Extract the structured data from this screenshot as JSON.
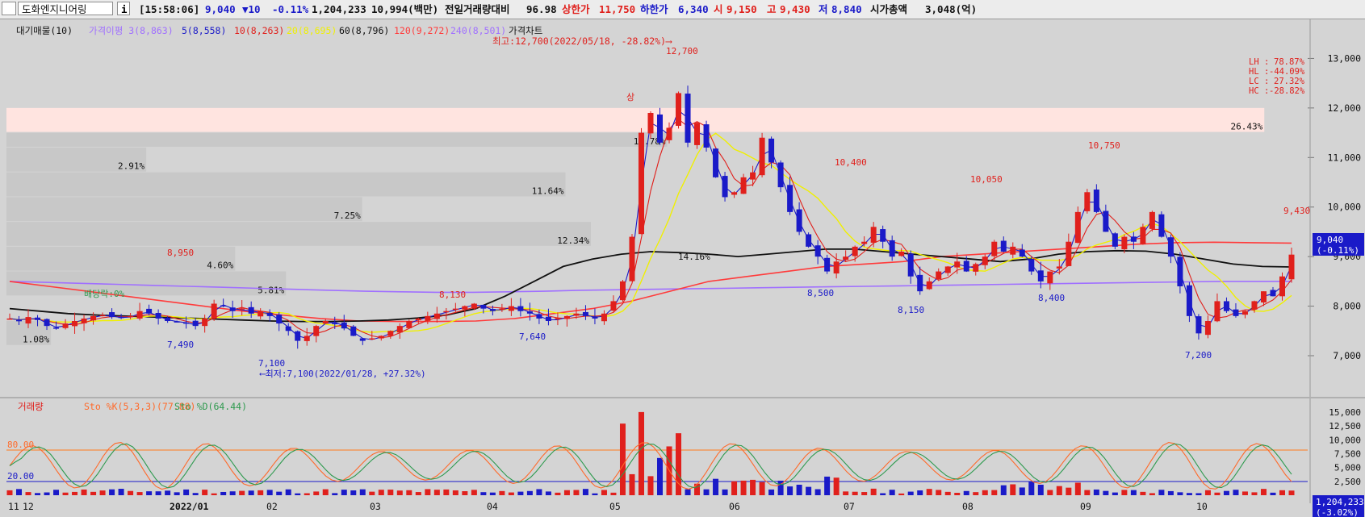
{
  "header": {
    "market_badge": "신",
    "stock_name": "도화엔지니어링",
    "info_button": "i",
    "time": "[15:58:06]",
    "price": "9,040",
    "change": "▼10",
    "change_pct": "-0.11%",
    "volume": "1,204,233",
    "amount": "10,994(백만)",
    "prev_vol_ratio_label": "전일거래량대비",
    "prev_vol_ratio": "96.98",
    "upper_limit_label": "상한가",
    "upper_limit": "11,750",
    "lower_limit_label": "하한가",
    "lower_limit": "6,340",
    "open_label": "시",
    "open": "9,150",
    "high_label": "고",
    "high": "9,430",
    "low_label": "저",
    "low": "8,840",
    "market_cap_label": "시가총액",
    "market_cap": "3,048(억)"
  },
  "colors": {
    "up": "#e0201c",
    "down": "#1a1ac8",
    "ma3": "#8a2be2",
    "ma5": "#1a1ac8",
    "ma10": "#e0201c",
    "ma20": "#f0f000",
    "ma60": "#111111",
    "ma120": "#ff3b3b",
    "ma240": "#a070ff",
    "stoK": "#ff6a2a",
    "stoD": "#2e9a4e",
    "bg": "#d4d4d4"
  },
  "chart_data": [
    {
      "type": "candlestick",
      "legend": [
        "대기매물(10)",
        "가격이평 3(8,863)",
        "5(8,558)",
        "10(8,263)",
        "20(8,695)",
        "60(8,796)",
        "120(9,272)",
        "240(8,501)",
        "가격차트"
      ],
      "yticks": [
        7000,
        8000,
        9000,
        10000,
        11000,
        12000,
        13000
      ],
      "ytick_labels": [
        "7,000",
        "8,000",
        "9,000",
        "10,000",
        "11,000",
        "12,000",
        "13,000"
      ],
      "ylim": [
        6300,
        13300
      ],
      "x_labels": [
        "11",
        "12",
        "2022/01",
        "02",
        "03",
        "04",
        "05",
        "06",
        "07",
        "08",
        "09",
        "10"
      ],
      "volume_profile": [
        {
          "low": 7200,
          "high": 7700,
          "pct": "1.08%",
          "fraction": 0.035
        },
        {
          "low": 7700,
          "high": 8200,
          "pct": "",
          "fraction": 0.0
        },
        {
          "low": 8200,
          "high": 8700,
          "pct": "5.81%",
          "fraction": 0.22
        },
        {
          "low": 8700,
          "high": 9200,
          "pct": "4.60%",
          "fraction": 0.18
        },
        {
          "low": 9200,
          "high": 9700,
          "pct": "12.34%",
          "fraction": 0.46
        },
        {
          "low": 9700,
          "high": 10200,
          "pct": "7.25%",
          "fraction": 0.28
        },
        {
          "low": 10200,
          "high": 10700,
          "pct": "11.64%",
          "fraction": 0.44
        },
        {
          "low": 10700,
          "high": 11200,
          "pct": "2.91%",
          "fraction": 0.11
        },
        {
          "low": 11500,
          "high": 12000,
          "pct": "26.43%",
          "fraction": 0.99
        },
        {
          "low": 11200,
          "high": 11500,
          "pct": "13.78%",
          "fraction": 0.52
        }
      ],
      "profile_extra_label": "14.16%",
      "price_points": [
        [
          "11",
          7750
        ],
        [
          "11",
          7700
        ],
        [
          "11",
          7780
        ],
        [
          "11",
          7720
        ],
        [
          "11",
          7600
        ],
        [
          "12",
          7550
        ],
        [
          "12",
          7650
        ],
        [
          "12",
          7700
        ],
        [
          "12",
          7750
        ],
        [
          "12",
          7800
        ],
        [
          "12",
          7820
        ],
        [
          "12",
          7780
        ],
        [
          "12",
          7760
        ],
        [
          "12",
          7800
        ],
        [
          "12",
          7900
        ],
        [
          "12",
          7850
        ],
        [
          "12",
          7750
        ],
        [
          "12",
          7700
        ],
        [
          "12",
          7680
        ],
        [
          "12",
          7650
        ],
        [
          "01",
          7600
        ],
        [
          "01",
          7750
        ],
        [
          "01",
          8050
        ],
        [
          "01",
          8000
        ],
        [
          "01",
          7900
        ],
        [
          "01",
          7950
        ],
        [
          "01",
          7850
        ],
        [
          "01",
          7900
        ],
        [
          "01",
          7800
        ],
        [
          "01",
          7650
        ],
        [
          "02",
          7500
        ],
        [
          "02",
          7300
        ],
        [
          "02",
          7400
        ],
        [
          "02",
          7600
        ],
        [
          "02",
          7700
        ],
        [
          "02",
          7650
        ],
        [
          "02",
          7550
        ],
        [
          "02",
          7400
        ],
        [
          "02",
          7300
        ],
        [
          "02",
          7350
        ],
        [
          "02",
          7400
        ],
        [
          "02",
          7500
        ],
        [
          "03",
          7600
        ],
        [
          "03",
          7700
        ],
        [
          "03",
          7750
        ],
        [
          "03",
          7800
        ],
        [
          "03",
          7850
        ],
        [
          "03",
          7900
        ],
        [
          "03",
          7950
        ],
        [
          "03",
          8000
        ],
        [
          "03",
          8050
        ],
        [
          "03",
          7950
        ],
        [
          "03",
          7900
        ],
        [
          "03",
          7950
        ],
        [
          "04",
          8000
        ],
        [
          "04",
          7900
        ],
        [
          "04",
          7850
        ],
        [
          "04",
          7750
        ],
        [
          "04",
          7700
        ],
        [
          "04",
          7750
        ],
        [
          "04",
          7800
        ],
        [
          "04",
          7850
        ],
        [
          "04",
          7800
        ],
        [
          "04",
          7750
        ],
        [
          "04",
          7850
        ],
        [
          "04",
          8100
        ],
        [
          "05",
          8500
        ],
        [
          "05",
          9400
        ],
        [
          "05",
          11500
        ],
        [
          "05",
          11900
        ],
        [
          "05",
          11300
        ],
        [
          "05",
          11600
        ],
        [
          "05",
          12300
        ],
        [
          "05",
          11300
        ],
        [
          "05",
          11700
        ],
        [
          "05",
          11200
        ],
        [
          "05",
          10600
        ],
        [
          "05",
          10200
        ],
        [
          "06",
          10300
        ],
        [
          "06",
          10600
        ],
        [
          "06",
          10700
        ],
        [
          "06",
          11400
        ],
        [
          "06",
          10900
        ],
        [
          "06",
          10400
        ],
        [
          "06",
          9900
        ],
        [
          "06",
          9500
        ],
        [
          "06",
          9200
        ],
        [
          "06",
          9000
        ],
        [
          "06",
          8700
        ],
        [
          "06",
          8900
        ],
        [
          "07",
          9000
        ],
        [
          "07",
          9200
        ],
        [
          "07",
          9300
        ],
        [
          "07",
          9600
        ],
        [
          "07",
          9300
        ],
        [
          "07",
          9000
        ],
        [
          "07",
          9100
        ],
        [
          "07",
          8600
        ],
        [
          "07",
          8300
        ],
        [
          "07",
          8500
        ],
        [
          "07",
          8700
        ],
        [
          "07",
          8800
        ],
        [
          "08",
          8900
        ],
        [
          "08",
          8700
        ],
        [
          "08",
          8850
        ],
        [
          "08",
          9000
        ],
        [
          "08",
          9300
        ],
        [
          "08",
          9100
        ],
        [
          "08",
          9200
        ],
        [
          "08",
          9000
        ],
        [
          "08",
          8700
        ],
        [
          "08",
          8500
        ],
        [
          "08",
          8700
        ],
        [
          "08",
          8800
        ],
        [
          "09",
          9300
        ],
        [
          "09",
          9900
        ],
        [
          "09",
          10300
        ],
        [
          "09",
          9900
        ],
        [
          "09",
          9500
        ],
        [
          "09",
          9200
        ],
        [
          "09",
          9400
        ],
        [
          "09",
          9300
        ],
        [
          "09",
          9600
        ],
        [
          "09",
          9900
        ],
        [
          "09",
          9400
        ],
        [
          "09",
          9000
        ],
        [
          "10",
          8400
        ],
        [
          "10",
          7800
        ],
        [
          "10",
          7450
        ],
        [
          "10",
          7700
        ],
        [
          "10",
          8100
        ],
        [
          "10",
          7900
        ],
        [
          "10",
          7800
        ],
        [
          "10",
          7900
        ],
        [
          "10",
          8100
        ],
        [
          "10",
          8300
        ],
        [
          "10",
          8200
        ],
        [
          "10",
          8600
        ],
        [
          "10",
          9040
        ]
      ],
      "ma60_points": [
        7950,
        7900,
        7850,
        7820,
        7800,
        7780,
        7760,
        7740,
        7720,
        7700,
        7690,
        7690,
        7700,
        7720,
        7760,
        7820,
        7950,
        8200,
        8500,
        8800,
        8950,
        9050,
        9100,
        9080,
        9050,
        9000,
        9050,
        9100,
        9150,
        9150,
        9100,
        9050,
        9000,
        8950,
        8900,
        8950,
        9050,
        9100,
        9120,
        9110,
        9050,
        8950,
        8850,
        8800,
        8790
      ],
      "ma240_points": [
        8500,
        8480,
        8460,
        8440,
        8420,
        8400,
        8380,
        8360,
        8340,
        8320,
        8300,
        8290,
        8280,
        8280,
        8290,
        8300,
        8320,
        8330,
        8340,
        8350,
        8360,
        8370,
        8380,
        8390,
        8400,
        8410,
        8420,
        8430,
        8440,
        8450,
        8460,
        8470,
        8480,
        8490,
        8500,
        8500,
        8501
      ],
      "ma120_points": [
        8500,
        8400,
        8300,
        8200,
        8100,
        8000,
        7900,
        7820,
        7750,
        7700,
        7690,
        7690,
        7700,
        7750,
        7850,
        7950,
        8100,
        8300,
        8500,
        8600,
        8700,
        8800,
        8850,
        8900,
        9000,
        9050,
        9100,
        9150,
        9200,
        9250,
        9280,
        9290,
        9280,
        9272
      ],
      "annotations": [
        {
          "text": "최고:12,700(2022/05/18, -28.82%)⟶",
          "color": "#e0201c"
        },
        {
          "text": "12,700",
          "color": "#e0201c",
          "price": 12700
        },
        {
          "text": "8,950",
          "color": "#e0201c",
          "price": 8950
        },
        {
          "text": "7,490",
          "color": "#1a1ac8",
          "price": 7490
        },
        {
          "text": "7,100",
          "color": "#1a1ac8",
          "price": 7100
        },
        {
          "text": "⟵최저:7,100(2022/01/28, +27.32%)",
          "color": "#1a1ac8"
        },
        {
          "text": "8,130",
          "color": "#e0201c",
          "price": 8130
        },
        {
          "text": "7,640",
          "color": "#1a1ac8",
          "price": 7640
        },
        {
          "text": "10,400",
          "color": "#e0201c",
          "price": 10400
        },
        {
          "text": "8,500",
          "color": "#1a1ac8",
          "price": 8500
        },
        {
          "text": "8,150",
          "color": "#1a1ac8",
          "price": 8150
        },
        {
          "text": "10,050",
          "color": "#e0201c",
          "price": 10050
        },
        {
          "text": "8,400",
          "color": "#1a1ac8",
          "price": 8400
        },
        {
          "text": "10,750",
          "color": "#e0201c",
          "price": 10750
        },
        {
          "text": "7,200",
          "color": "#1a1ac8",
          "price": 7200
        },
        {
          "text": "9,430",
          "color": "#e0201c",
          "price": 9430
        },
        {
          "text": "배당락:0%",
          "color": "#2e9a4e"
        },
        {
          "text": "상",
          "color": "#e0201c"
        }
      ],
      "stats": {
        "LH": "78.87%",
        "HL": "-44.09%",
        "LC": "27.32%",
        "HC": "-28.82%"
      },
      "current_price_label": "9,040",
      "current_change_label": "(-0.11%)"
    },
    {
      "type": "volume_stochastic",
      "legend": [
        "거래량",
        "Sto %K(5,3,3)(77.88)",
        "Sto %D(64.44)"
      ],
      "yticks": [
        2500,
        5000,
        7500,
        10000,
        12500,
        15000
      ],
      "ytick_labels": [
        "2,500",
        "5,000",
        "7,500",
        "10,000",
        "12,500",
        "15,000"
      ],
      "ylim": [
        0,
        16000
      ],
      "sto_levels": [
        80.0,
        20.0
      ],
      "sto_level_labels": [
        "80.00",
        "20.00"
      ],
      "current_volume_label": "1,204,233",
      "current_volume_change": "(-3.02%)"
    }
  ]
}
